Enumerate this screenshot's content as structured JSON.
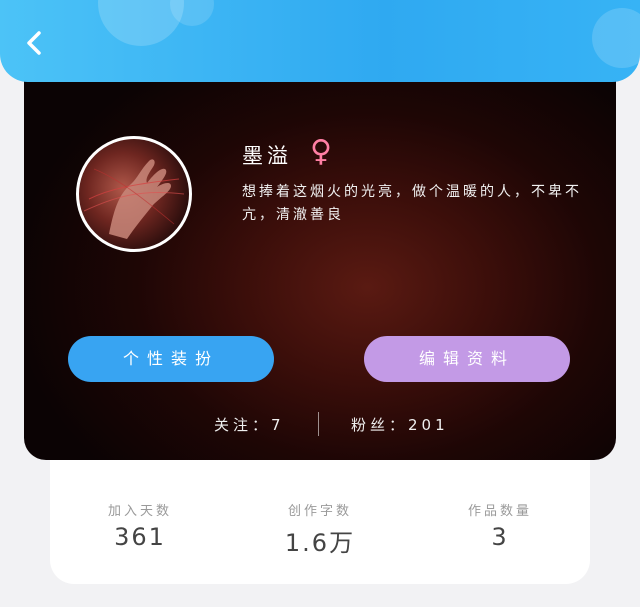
{
  "header": {
    "back_icon": "chevron-left-icon"
  },
  "profile": {
    "name": "墨溢",
    "gender_symbol": "♀",
    "gender_color": "#ff7fa4",
    "bio": "想捧着这烟火的光亮，做个温暖的人，不卑不亢，清澈善良",
    "buttons": {
      "decor_label": "个性装扮",
      "edit_label": "编辑资料"
    },
    "follow_label": "关注：7",
    "fans_label": "粉丝：201"
  },
  "stats": [
    {
      "label": "加入天数",
      "value": "361"
    },
    {
      "label": "创作字数",
      "value": "1.6万"
    },
    {
      "label": "作品数量",
      "value": "3"
    }
  ],
  "colors": {
    "header_blue": "#2fa9f1",
    "decor_button": "#38a4f2",
    "edit_button": "#c39ae6"
  }
}
